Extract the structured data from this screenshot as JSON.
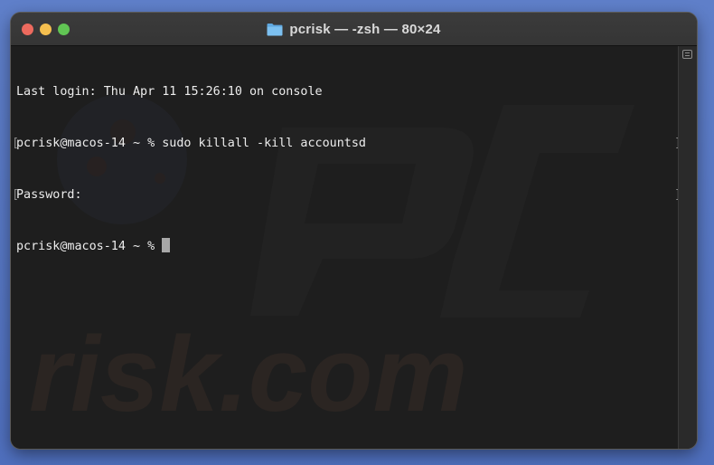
{
  "window": {
    "title": "pcrisk — -zsh — 80×24",
    "title_icon": "folder-icon",
    "colors": {
      "close": "#ed6a5e",
      "minimize": "#f5bf4f",
      "zoom": "#61c554",
      "terminal_bg": "#1e1e1e",
      "terminal_text": "#ededed",
      "desktop": "#5f7fc9"
    }
  },
  "terminal": {
    "lines": [
      "Last login: Thu Apr 11 15:26:10 on console",
      "pcrisk@macos-14 ~ % sudo killall -kill accountsd",
      "Password:",
      "pcrisk@macos-14 ~ %"
    ],
    "marks": {
      "open": "[",
      "close": "]"
    }
  },
  "watermark": {
    "text": "risk.com"
  }
}
